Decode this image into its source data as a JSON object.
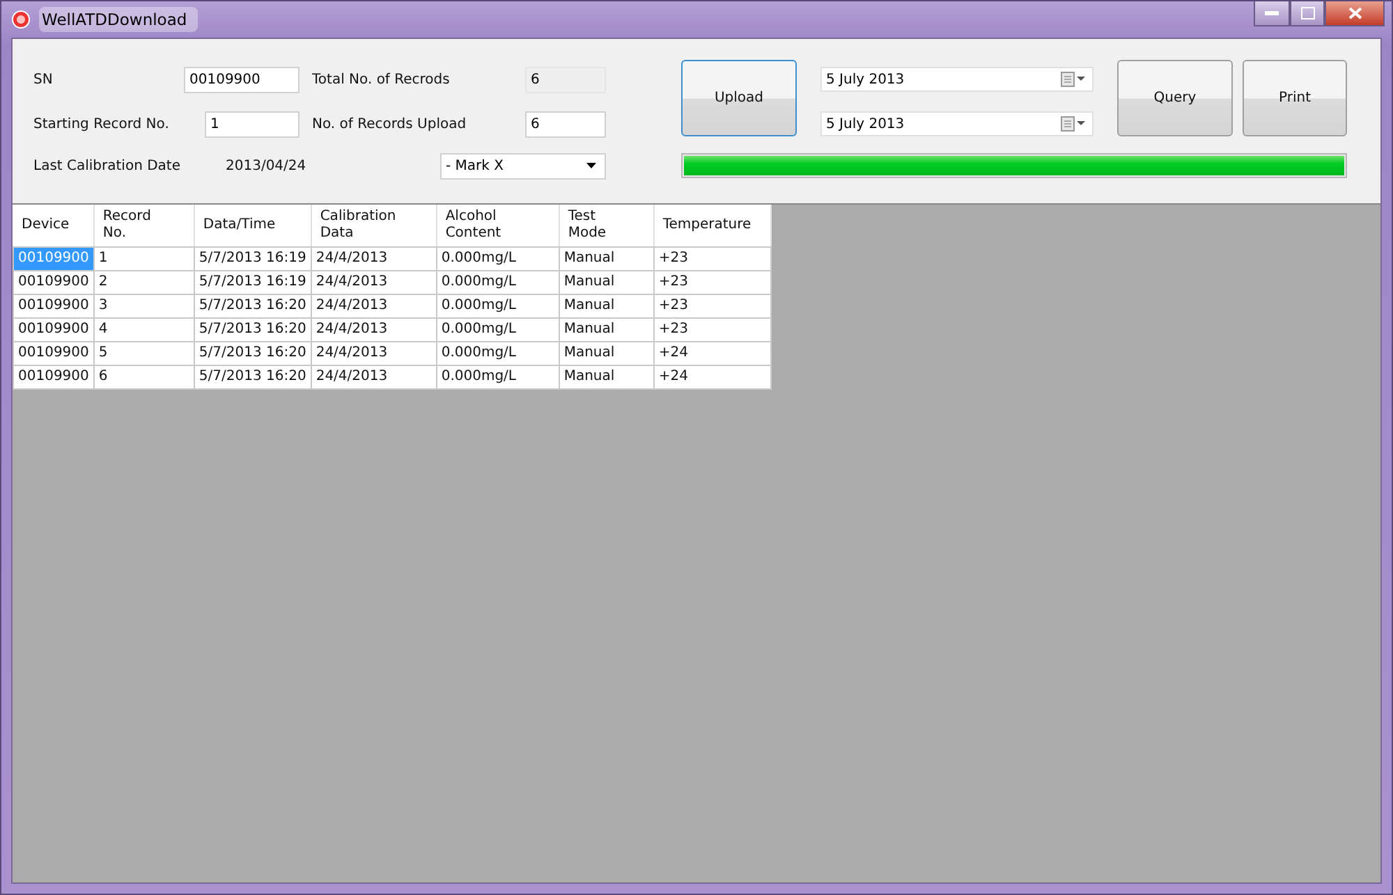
{
  "window": {
    "title": "WellATDDownload"
  },
  "form": {
    "sn_label": "SN",
    "sn": "00109900",
    "start_label": "Starting Record No.",
    "start": "1",
    "calib_label": "Last Calibration Date",
    "calib": "2013/04/24",
    "total_label": "Total No. of Recrods",
    "total": "6",
    "upload_count_label": "No. of Records Upload",
    "upload_count": "6",
    "operator": "- Mark X",
    "upload_button": "Upload",
    "date_from": "5 July 2013",
    "date_to": "5 July 2013",
    "query_button": "Query",
    "print_button": "Print",
    "progress": {
      "level": 1
    }
  },
  "table": {
    "columns": [
      "Device",
      "Record\nNo.",
      "Data/Time",
      "Calibration\nData",
      "Alcohol\nContent",
      "Test\nMode",
      "Temperature"
    ],
    "rows": [
      {
        "selected": true,
        "cells": [
          "00109900",
          "1",
          "5/7/2013 16:19",
          "24/4/2013",
          "0.000mg/L",
          "Manual",
          "+23"
        ]
      },
      {
        "selected": false,
        "cells": [
          "00109900",
          "2",
          "5/7/2013 16:19",
          "24/4/2013",
          "0.000mg/L",
          "Manual",
          "+23"
        ]
      },
      {
        "selected": false,
        "cells": [
          "00109900",
          "3",
          "5/7/2013 16:20",
          "24/4/2013",
          "0.000mg/L",
          "Manual",
          "+23"
        ]
      },
      {
        "selected": false,
        "cells": [
          "00109900",
          "4",
          "5/7/2013 16:20",
          "24/4/2013",
          "0.000mg/L",
          "Manual",
          "+23"
        ]
      },
      {
        "selected": false,
        "cells": [
          "00109900",
          "5",
          "5/7/2013 16:20",
          "24/4/2013",
          "0.000mg/L",
          "Manual",
          "+24"
        ]
      },
      {
        "selected": false,
        "cells": [
          "00109900",
          "6",
          "5/7/2013 16:20",
          "24/4/2013",
          "0.000mg/L",
          "Manual",
          "+24"
        ]
      }
    ]
  }
}
